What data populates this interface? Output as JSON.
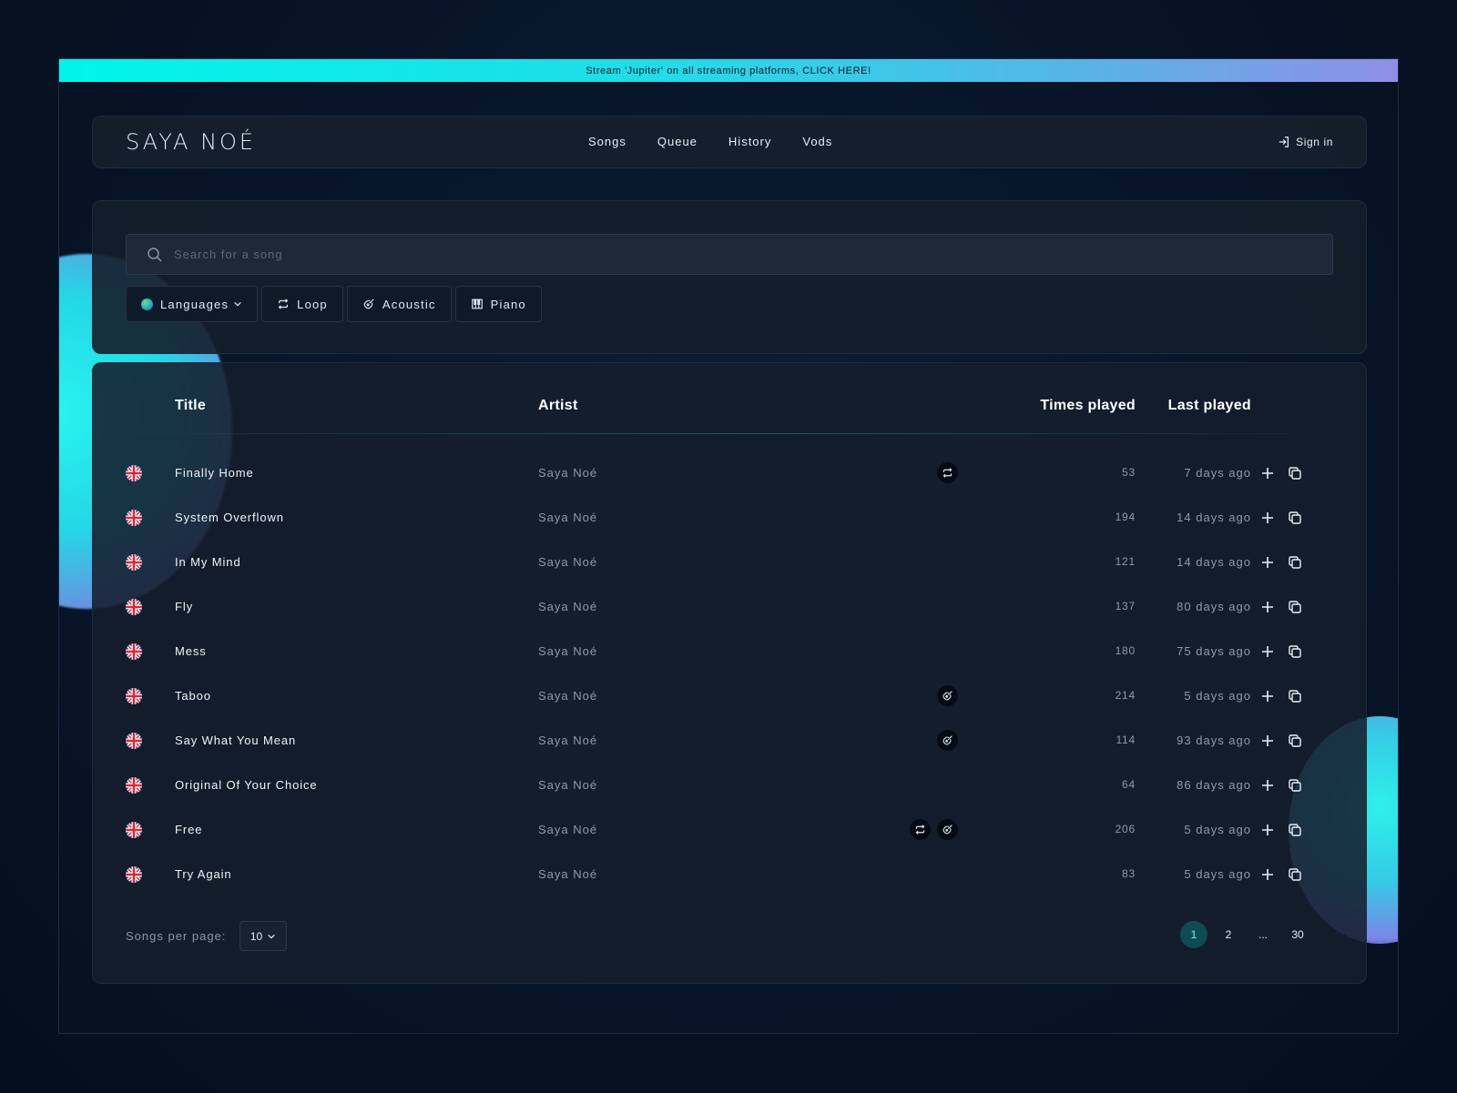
{
  "announcement": "Stream 'Jupiter' on all streaming platforms, CLICK HERE!",
  "brand": "SAYA NOÉ",
  "nav": [
    "Songs",
    "Queue",
    "History",
    "Vods"
  ],
  "signin_label": "Sign in",
  "search": {
    "placeholder": "Search for a song"
  },
  "filters": {
    "languages": "Languages",
    "loop": "Loop",
    "acoustic": "Acoustic",
    "piano": "Piano"
  },
  "table": {
    "headers": {
      "title": "Title",
      "artist": "Artist",
      "plays": "Times played",
      "last": "Last played"
    },
    "rows": [
      {
        "title": "Finally Home",
        "artist": "Saya Noé",
        "plays": "53",
        "last": "7 days ago",
        "tags": [
          "loop"
        ]
      },
      {
        "title": "System Overflown",
        "artist": "Saya Noé",
        "plays": "194",
        "last": "14 days ago",
        "tags": []
      },
      {
        "title": "In My Mind",
        "artist": "Saya Noé",
        "plays": "121",
        "last": "14 days ago",
        "tags": []
      },
      {
        "title": "Fly",
        "artist": "Saya Noé",
        "plays": "137",
        "last": "80 days ago",
        "tags": []
      },
      {
        "title": "Mess",
        "artist": "Saya Noé",
        "plays": "180",
        "last": "75 days ago",
        "tags": []
      },
      {
        "title": "Taboo",
        "artist": "Saya Noé",
        "plays": "214",
        "last": "5 days ago",
        "tags": [
          "acoustic"
        ]
      },
      {
        "title": "Say What You Mean",
        "artist": "Saya Noé",
        "plays": "114",
        "last": "93 days ago",
        "tags": [
          "acoustic"
        ]
      },
      {
        "title": "Original Of Your Choice",
        "artist": "Saya Noé",
        "plays": "64",
        "last": "86 days ago",
        "tags": []
      },
      {
        "title": "Free",
        "artist": "Saya Noé",
        "plays": "206",
        "last": "5 days ago",
        "tags": [
          "loop",
          "acoustic"
        ]
      },
      {
        "title": "Try Again",
        "artist": "Saya Noé",
        "plays": "83",
        "last": "5 days ago",
        "tags": []
      }
    ]
  },
  "footer": {
    "per_page_label": "Songs per page:",
    "per_page_value": "10",
    "pages": [
      "1",
      "2",
      "...",
      "30"
    ],
    "current_page": "1"
  },
  "icons": {
    "row_language_flag": "uk-flag-icon",
    "row_add": "plus-icon",
    "row_copy": "copy-icon",
    "tag_loop": "loop-icon",
    "tag_acoustic": "guitar-icon"
  },
  "colors": {
    "accent": "#00f5ea",
    "background": "#071426",
    "active_page": "#0e4b55"
  }
}
